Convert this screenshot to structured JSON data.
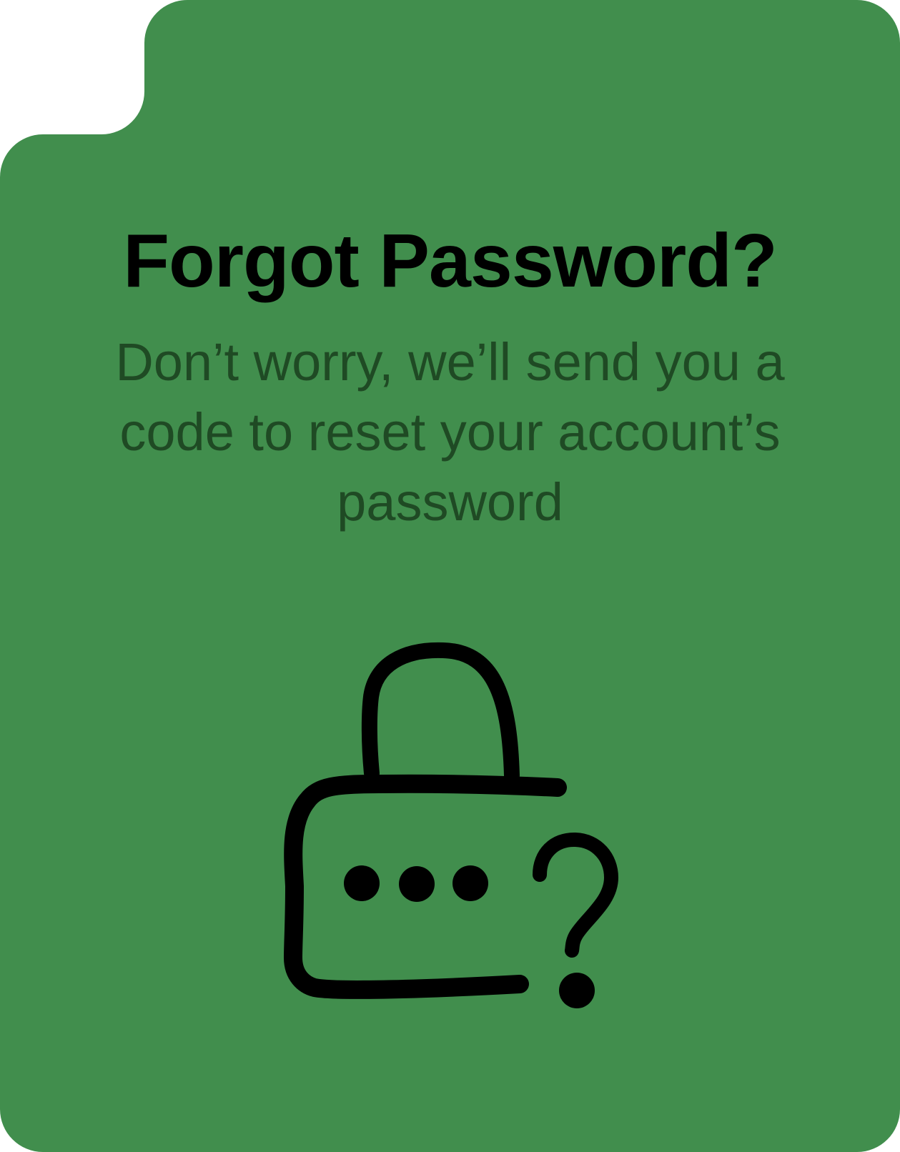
{
  "screen": {
    "title": "Forgot Password?",
    "description": "Don’t worry, we’ll send you a code to reset your account’s password"
  },
  "illustration": {
    "icon": "padlock-question-icon"
  },
  "colors": {
    "card_background": "#418e4d",
    "title_text": "#000000",
    "description_text": "#1f4a24",
    "page_background": "#ffffff",
    "icon_stroke": "#000000"
  }
}
